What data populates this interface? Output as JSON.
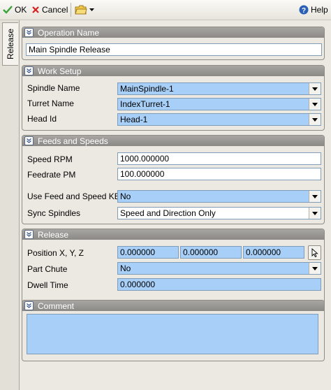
{
  "toolbar": {
    "ok_label": "OK",
    "cancel_label": "Cancel",
    "help_label": "Help"
  },
  "side_tab": {
    "label": "Release"
  },
  "operation_name": {
    "title": "Operation Name",
    "value": "Main Spindle Release"
  },
  "work_setup": {
    "title": "Work Setup",
    "spindle_name_label": "Spindle Name",
    "spindle_name_value": "MainSpindle-1",
    "turret_name_label": "Turret Name",
    "turret_name_value": "IndexTurret-1",
    "head_id_label": "Head Id",
    "head_id_value": "Head-1"
  },
  "feeds_speeds": {
    "title": "Feeds and Speeds",
    "speed_label": "Speed RPM",
    "speed_value": "1000.000000",
    "feedrate_label": "Feedrate PM",
    "feedrate_value": "100.000000",
    "use_kb_label": "Use Feed and Speed KB",
    "use_kb_value": "No",
    "sync_label": "Sync Spindles",
    "sync_value": "Speed and Direction Only"
  },
  "release": {
    "title": "Release",
    "position_label": "Position X, Y, Z",
    "x_value": "0.000000",
    "y_value": "0.000000",
    "z_value": "0.000000",
    "part_chute_label": "Part Chute",
    "part_chute_value": "No",
    "dwell_label": "Dwell Time",
    "dwell_value": "0.000000"
  },
  "comment": {
    "title": "Comment",
    "value": ""
  }
}
